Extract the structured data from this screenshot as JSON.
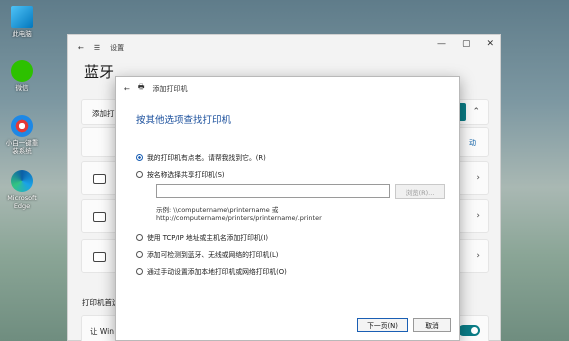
{
  "desktop": {
    "icons": [
      {
        "label": "此电脑"
      },
      {
        "label": "微信"
      },
      {
        "label": "小白一键重装系统"
      },
      {
        "label": "Microsoft Edge"
      }
    ]
  },
  "settings": {
    "nav_title": "设置",
    "page_title": "蓝牙",
    "add_row_label": "添加打",
    "link_fragment": "动",
    "printers_section": "打印机首选",
    "bottom_row_label": "让 Win",
    "window_controls": [
      "—",
      "▢",
      "✕"
    ]
  },
  "dialog": {
    "title": "添加打印机",
    "heading": "按其他选项查找打印机",
    "options": [
      {
        "label": "我的打印机有点老。请帮我找到它。(R)",
        "selected": true
      },
      {
        "label": "按名称选择共享打印机(S)",
        "selected": false
      },
      {
        "label": "使用 TCP/IP 地址或主机名添加打印机(I)",
        "selected": false
      },
      {
        "label": "添加可检测到蓝牙、无线或网络的打印机(L)",
        "selected": false
      },
      {
        "label": "通过手动设置添加本地打印机或网络打印机(O)",
        "selected": false
      }
    ],
    "share_input_value": "",
    "browse_label": "浏览(R)...",
    "example_line1": "示例: \\\\computername\\printername 或",
    "example_line2": "http://computername/printers/printername/.printer",
    "next_label": "下一页(N)",
    "cancel_label": "取消"
  },
  "colors": {
    "accent": "#0a7c86",
    "heading": "#1a4f9c"
  }
}
